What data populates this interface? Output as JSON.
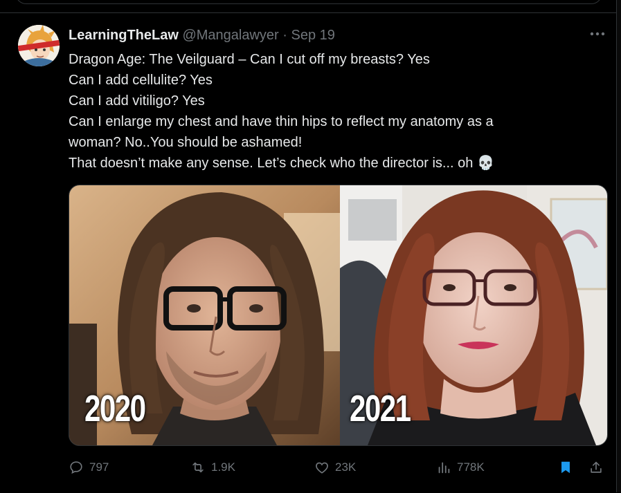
{
  "tweet": {
    "display_name": "LearningTheLaw",
    "handle": "@Mangalawyer",
    "separator": "·",
    "time": "Sep 19",
    "lines": [
      "Dragon Age: The Veilguard – Can I cut off my breasts? Yes",
      "Can I add cellulite? Yes",
      "Can I add vitiligo? Yes",
      "Can I enlarge my chest and have thin hips to reflect my anatomy as a",
      "woman? No..You should be ashamed!",
      "That doesn’t make any sense. Let’s check who the director is... oh 💀"
    ],
    "media": {
      "left_label": "2020",
      "right_label": "2021"
    },
    "stats": {
      "replies": "797",
      "reposts": "1.9K",
      "likes": "23K",
      "views": "778K"
    }
  },
  "colors": {
    "background": "#000000",
    "text": "#e7e9ea",
    "muted": "#71767b",
    "border": "#2f3336",
    "bookmark_active": "#1d9bf0"
  },
  "icons": {
    "more": "more-horizontal-icon",
    "reply": "reply-icon",
    "repost": "repost-icon",
    "like": "heart-icon",
    "views": "analytics-icon",
    "bookmark": "bookmark-icon",
    "share": "share-icon"
  }
}
